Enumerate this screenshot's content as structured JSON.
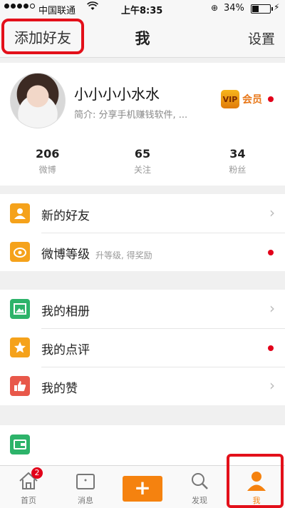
{
  "status": {
    "carrier": "中国联通",
    "time": "上午8:35",
    "battery": "34%"
  },
  "nav": {
    "left": "添加好友",
    "title": "我",
    "right": "设置"
  },
  "profile": {
    "name": "小小小小水水",
    "intro": "简介: 分享手机赚钱软件, ...",
    "vip_label": "会员",
    "vip_badge": "VIP",
    "stats": [
      {
        "value": "206",
        "label": "微博"
      },
      {
        "value": "65",
        "label": "关注"
      },
      {
        "value": "34",
        "label": "粉丝"
      }
    ]
  },
  "menu": {
    "new_friends": "新的好友",
    "weibo_level": "微博等级",
    "weibo_level_sub": "升等级, 得奖励",
    "album": "我的相册",
    "comments": "我的点评",
    "likes": "我的赞"
  },
  "tabs": {
    "home": "首页",
    "home_badge": "2",
    "messages": "消息",
    "discover": "发现",
    "me": "我"
  },
  "colors": {
    "accent_orange": "#f5820f",
    "highlight_red": "#e3101a",
    "green": "#2db36a",
    "red_icon": "#e8584a"
  }
}
